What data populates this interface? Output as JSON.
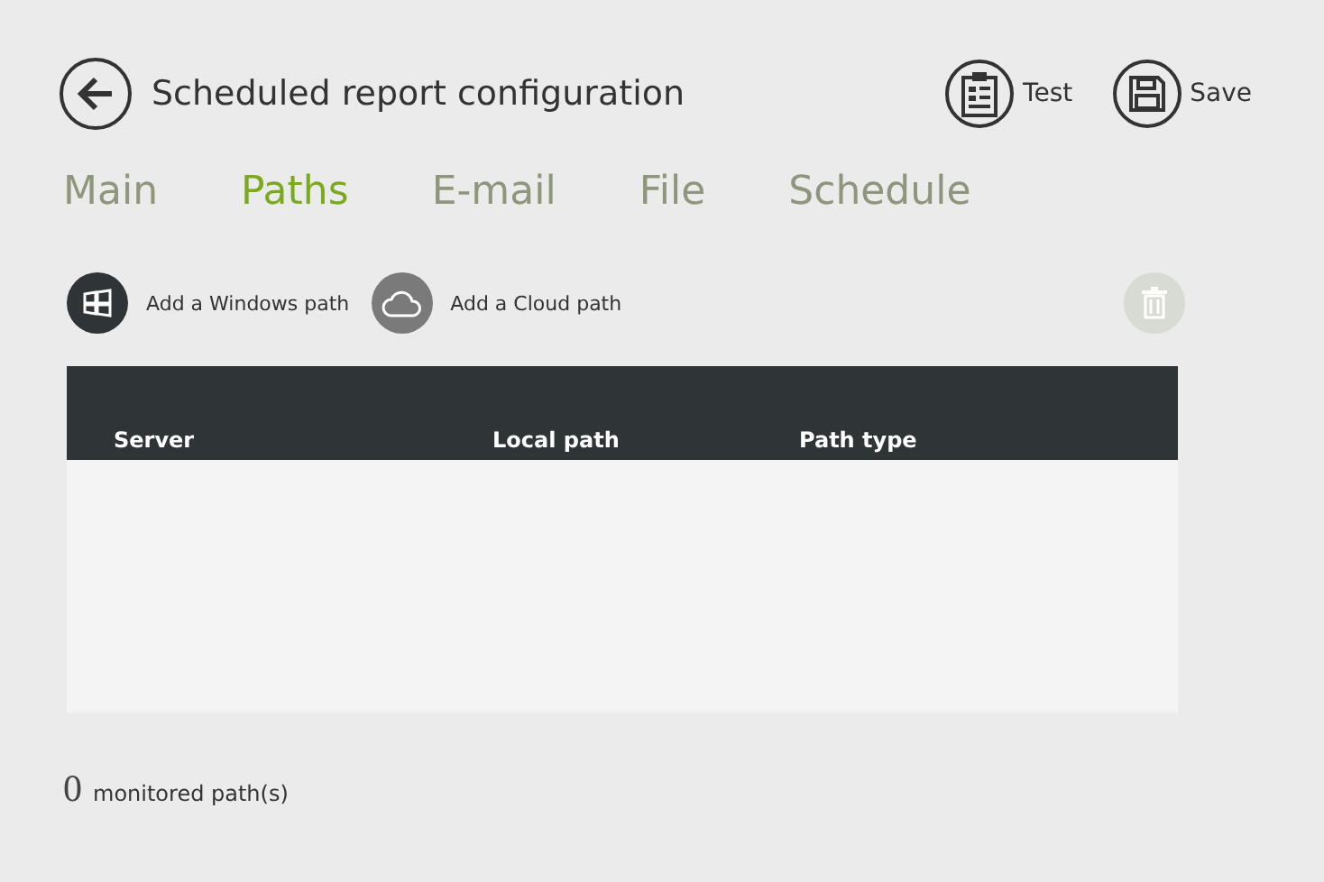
{
  "header": {
    "title": "Scheduled report configuration",
    "actions": [
      {
        "kind": "test",
        "label": "Test"
      },
      {
        "kind": "save",
        "label": "Save"
      }
    ]
  },
  "tabs": [
    {
      "label": "Main",
      "selected": false
    },
    {
      "label": "Paths",
      "selected": true
    },
    {
      "label": "E-mail",
      "selected": false
    },
    {
      "label": "File",
      "selected": false
    },
    {
      "label": "Schedule",
      "selected": false
    }
  ],
  "toolbar": [
    {
      "kind": "windows",
      "label": "Add a Windows path",
      "disabled": false
    },
    {
      "kind": "cloud",
      "label": "Add a Cloud path",
      "disabled": false
    },
    {
      "kind": "delete",
      "disabled": true
    }
  ],
  "table": {
    "columns": [
      "Server",
      "Local path",
      "Path type"
    ]
  },
  "footer": {
    "count": "0",
    "label": "monitored path(s)"
  }
}
